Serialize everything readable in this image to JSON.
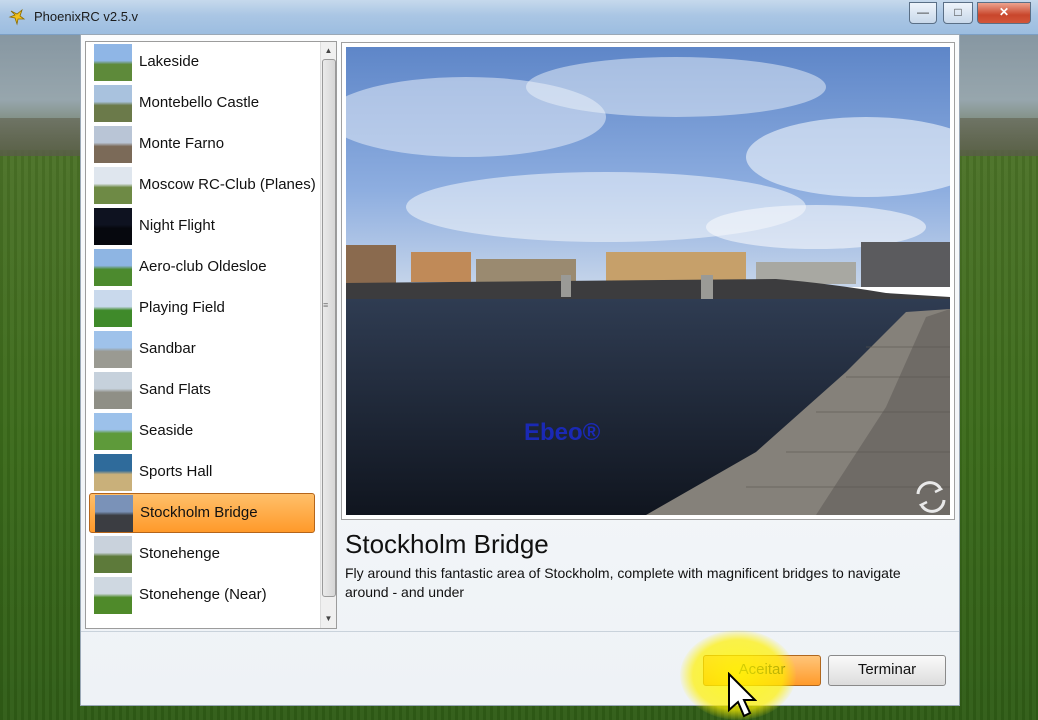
{
  "window": {
    "title": "PhoenixRC v2.5.v",
    "minimize": "—",
    "maximize": "□",
    "close": "✕"
  },
  "scene_list": {
    "items": [
      {
        "label": "Lakeside",
        "thumb": [
          "#8fb6e6",
          "#5e8a3a"
        ]
      },
      {
        "label": "Montebello Castle",
        "thumb": [
          "#a9c2de",
          "#6b7a4a"
        ]
      },
      {
        "label": "Monte Farno",
        "thumb": [
          "#b9c5d6",
          "#7b6a58"
        ]
      },
      {
        "label": "Moscow RC-Club (Planes)",
        "thumb": [
          "#dfe6ee",
          "#6e8a45"
        ]
      },
      {
        "label": "Night Flight",
        "thumb": [
          "#0e1220",
          "#06080e"
        ]
      },
      {
        "label": "Aero-club Oldesloe",
        "thumb": [
          "#8eb5e3",
          "#4c8a2e"
        ]
      },
      {
        "label": "Playing Field",
        "thumb": [
          "#c9d9ec",
          "#3f8a2a"
        ]
      },
      {
        "label": "Sandbar",
        "thumb": [
          "#9fc2ea",
          "#9a9a92"
        ]
      },
      {
        "label": "Sand Flats",
        "thumb": [
          "#c6d1dc",
          "#8f8f86"
        ]
      },
      {
        "label": "Seaside",
        "thumb": [
          "#9cc1ea",
          "#5e9a3a"
        ]
      },
      {
        "label": "Sports Hall",
        "thumb": [
          "#2f6b9b",
          "#c9b07a"
        ]
      },
      {
        "label": "Stockholm Bridge",
        "thumb": [
          "#7a92b8",
          "#3b3d42"
        ],
        "selected": true
      },
      {
        "label": "Stonehenge",
        "thumb": [
          "#c9d2dc",
          "#5d7a3a"
        ]
      },
      {
        "label": "Stonehenge (Near)",
        "thumb": [
          "#cfd8e1",
          "#4f8a2a"
        ]
      }
    ]
  },
  "preview": {
    "watermark": "Ebeo®",
    "refresh_icon": "refresh-icon"
  },
  "selected_scene": {
    "name": "Stockholm Bridge",
    "description": "Fly around this fantastic area of Stockholm, complete with magnificent bridges to navigate around - and under"
  },
  "buttons": {
    "accept": "Aceitar",
    "finish": "Terminar"
  }
}
